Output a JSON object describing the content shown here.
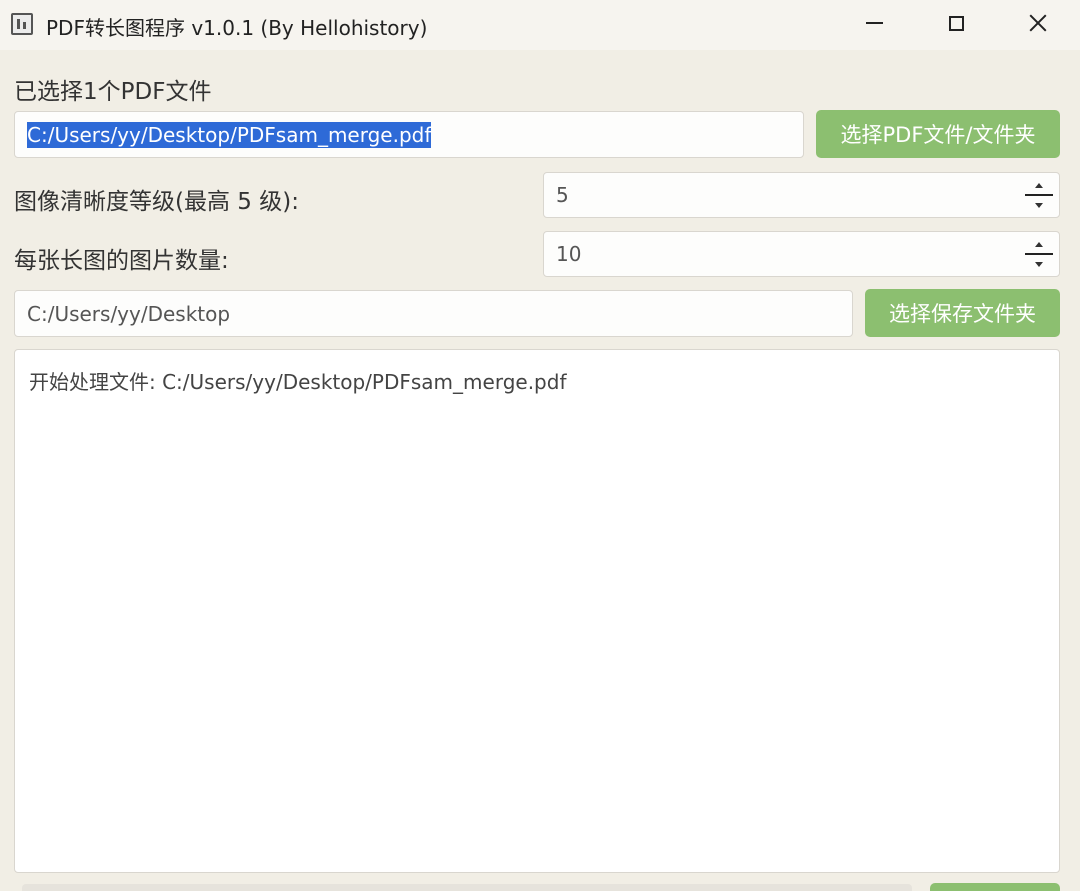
{
  "window": {
    "title": "PDF转长图程序 v1.0.1 (By Hellohistory)",
    "icon": "app-icon"
  },
  "window_controls": {
    "minimize_icon": "minimize-icon",
    "maximize_icon": "maximize-icon",
    "close_icon": "close-icon"
  },
  "pdf_section": {
    "status_label": "已选择1个PDF文件",
    "file_path": "C:/Users/yy/Desktop/PDFsam_merge.pdf",
    "select_button": "选择PDF文件/文件夹"
  },
  "clarity": {
    "label": "图像清晰度等级(最高 5 级):",
    "value": "5"
  },
  "images_per_long": {
    "label": "每张长图的图片数量:",
    "value": "10"
  },
  "save_section": {
    "folder_path": "C:/Users/yy/Desktop",
    "select_button": "选择保存文件夹"
  },
  "log": {
    "lines": [
      "开始处理文件: C:/Users/yy/Desktop/PDFsam_merge.pdf"
    ]
  },
  "colors": {
    "accent_green": "#8cbf70",
    "selection_blue": "#2e6ad7",
    "window_bg": "#f1eee5"
  }
}
